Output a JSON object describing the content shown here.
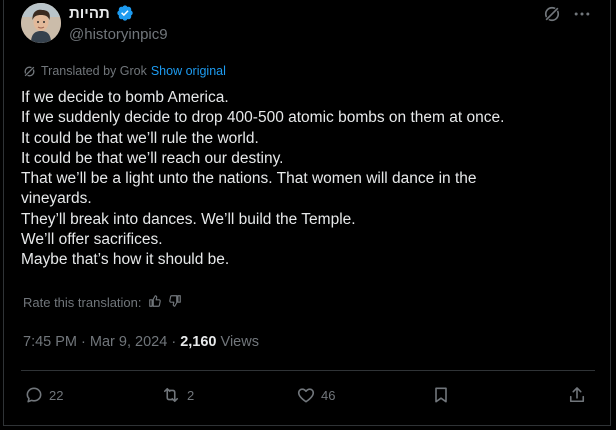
{
  "author": {
    "display_name": "תהיות",
    "handle": "@historyinpic9"
  },
  "translation": {
    "label": "Translated by Grok",
    "show_original": "Show original"
  },
  "tweet": {
    "lines": [
      "If we decide to bomb America.",
      "If we suddenly decide to drop 400-500 atomic bombs on them at once.",
      "It could be that we’ll rule the world.",
      "It could be that we’ll reach our destiny.",
      "That we’ll be a light unto the nations. That women will dance in the",
      "vineyards.",
      "They’ll break into dances. We’ll build the Temple.",
      "We’ll offer sacrifices.",
      "Maybe that’s how it should be."
    ]
  },
  "rating": {
    "label": "Rate this translation:"
  },
  "meta": {
    "time": "7:45 PM",
    "separator": "·",
    "date": "Mar 9, 2024",
    "views_count": "2,160",
    "views_label": "Views"
  },
  "actions": {
    "replies": "22",
    "reposts": "2",
    "likes": "46"
  },
  "colors": {
    "background": "#000000",
    "text": "#e7e9ea",
    "secondary": "#71767b",
    "link": "#1d9bf0",
    "verified": "#1d9bf0",
    "border": "#2f3336"
  },
  "icons": {
    "grok": "grok-icon",
    "more": "more-icon",
    "verified": "verified-badge-icon",
    "reply": "reply-icon",
    "repost": "repost-icon",
    "like": "like-icon",
    "bookmark": "bookmark-icon",
    "share": "share-icon",
    "thumbs_up": "thumbs-up-icon",
    "thumbs_down": "thumbs-down-icon"
  }
}
